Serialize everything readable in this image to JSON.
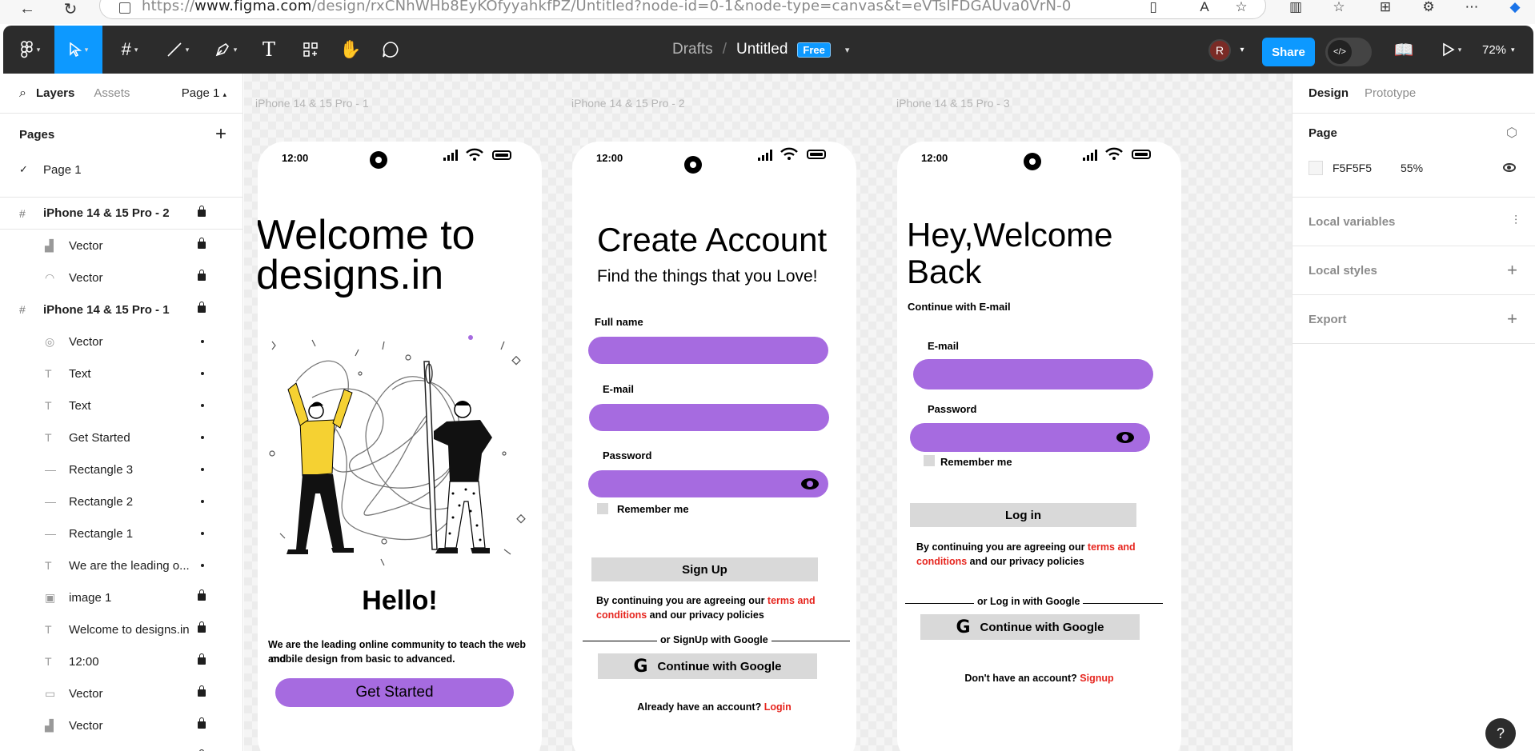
{
  "browser": {
    "url_prefix": "https://",
    "url_host": "www.figma.com",
    "url_rest": "/design/rxCNhWHb8EyKOfyyahkfPZ/Untitled?node-id=0-1&node-type=canvas&t=eVTsIFDGAUva0VrN-0"
  },
  "toolbar": {
    "drafts": "Drafts",
    "separator": "/",
    "file_name": "Untitled",
    "plan_badge": "Free",
    "avatar_initial": "R",
    "share_label": "Share",
    "zoom": "72%"
  },
  "left_panel": {
    "tabs": [
      "Layers",
      "Assets"
    ],
    "page_selector": "Page 1",
    "pages_title": "Pages",
    "pages": [
      {
        "name": "Page 1",
        "selected": true
      }
    ],
    "layers": [
      {
        "name": "iPhone 14 & 15 Pro - 2",
        "kind": "frame",
        "icon": "frame-icon",
        "lock": true
      },
      {
        "name": "Vector",
        "kind": "child",
        "icon": "signal-icon",
        "lock": true
      },
      {
        "name": "Vector",
        "kind": "child",
        "icon": "wifi-icon",
        "lock": true
      },
      {
        "name": "iPhone 14 & 15 Pro - 1",
        "kind": "frame",
        "icon": "frame-icon",
        "lock": true
      },
      {
        "name": "Vector",
        "kind": "child",
        "icon": "ellipse-icon",
        "lock": false
      },
      {
        "name": "Text",
        "kind": "child",
        "icon": "text-icon",
        "lock": false
      },
      {
        "name": "Text",
        "kind": "child",
        "icon": "text-icon",
        "lock": false
      },
      {
        "name": "Get Started",
        "kind": "child",
        "icon": "text-icon",
        "lock": false
      },
      {
        "name": "Rectangle 3",
        "kind": "child",
        "icon": "line-icon",
        "lock": false
      },
      {
        "name": "Rectangle 2",
        "kind": "child",
        "icon": "line-icon",
        "lock": false
      },
      {
        "name": "Rectangle 1",
        "kind": "child",
        "icon": "line-icon",
        "lock": false
      },
      {
        "name": "We are the leading o...",
        "kind": "child",
        "icon": "text-icon",
        "lock": false
      },
      {
        "name": "image 1",
        "kind": "child",
        "icon": "image-icon",
        "lock": true
      },
      {
        "name": "Welcome to designs.in",
        "kind": "child",
        "icon": "text-icon",
        "lock": true
      },
      {
        "name": "12:00",
        "kind": "child",
        "icon": "text-icon",
        "lock": true
      },
      {
        "name": "Vector",
        "kind": "child",
        "icon": "battery-icon",
        "lock": true
      },
      {
        "name": "Vector",
        "kind": "child",
        "icon": "signal-icon",
        "lock": true
      },
      {
        "name": "Vector",
        "kind": "child",
        "icon": "wifi-icon",
        "lock": true
      }
    ]
  },
  "canvas": {
    "frame_labels": [
      "iPhone 14 & 15 Pro - 1",
      "iPhone 14 & 15 Pro - 2",
      "iPhone 14 & 15 Pro - 3"
    ],
    "status_time": "12:00",
    "screen1": {
      "title_line1": "Welcome  to",
      "title_line2": "designs.in",
      "hello": "Hello!",
      "tagline_line1": "We are the leading online community to teach the web and",
      "tagline_line2": "mobile design from basic to advanced.",
      "cta": "Get Started"
    },
    "screen2": {
      "title": "Create Account",
      "subtitle": "Find the things that you Love!",
      "fullname_label": "Full name",
      "email_label": "E-mail",
      "password_label": "Password",
      "remember": "Remember me",
      "signup": "Sign Up",
      "terms_prefix": "By continuing you are agreeing our ",
      "terms_link1": "terms and",
      "terms_link2": "conditions",
      "terms_suffix": " and our privacy policies",
      "or_text": "or SignUp with Google",
      "google_btn": "Continue with Google",
      "google_glyph": "G",
      "footer_text": "Already have an account? ",
      "footer_link": "Login"
    },
    "screen3": {
      "title_line1": "Hey,Welcome",
      "title_line2": "Back",
      "subtitle": "Continue with E-mail",
      "email_label": "E-mail",
      "password_label": "Password",
      "remember": "Remember me",
      "login": "Log in",
      "terms_prefix": "By continuing you are agreeing our ",
      "terms_link1": "terms and",
      "terms_link2": "conditions",
      "terms_suffix": " and our privacy policies",
      "or_text": "or Log in with Google",
      "google_btn": "Continue with Google",
      "google_glyph": "G",
      "footer_text": "Don't have an account? ",
      "footer_link": "Signup"
    }
  },
  "right_panel": {
    "tabs": [
      "Design",
      "Prototype"
    ],
    "page_title": "Page",
    "bg_color": "F5F5F5",
    "bg_opacity": "55%",
    "local_variables": "Local variables",
    "local_styles": "Local styles",
    "export": "Export"
  },
  "help": "?",
  "colors": {
    "accent": "#0d99ff",
    "field_purple": "#a66be0",
    "link_red": "#e6261f",
    "toolbar_bg": "#2c2c2c"
  }
}
